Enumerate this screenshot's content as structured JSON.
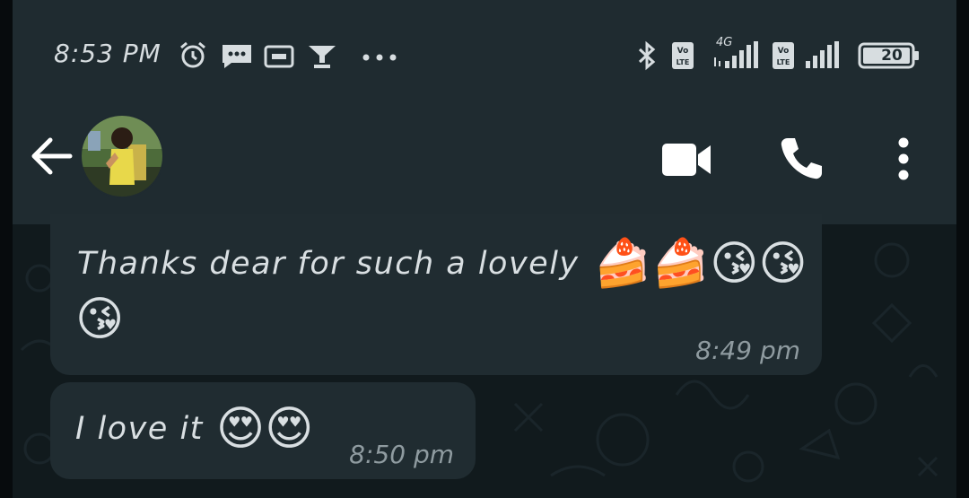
{
  "status_bar": {
    "time": "8:53 PM",
    "battery": "20",
    "network_label": "4G",
    "sim_labels": [
      "Vo LTE",
      "Vo LTE"
    ],
    "icons": [
      "alarm-icon",
      "message-icon",
      "screen-icon",
      "funnel-icon",
      "more-dots-icon",
      "bluetooth-icon",
      "volte-icon",
      "signal-icon",
      "battery-icon"
    ]
  },
  "app_bar": {
    "icons": [
      "back-arrow-icon",
      "avatar",
      "video-call-icon",
      "phone-call-icon",
      "more-vert-icon"
    ]
  },
  "messages": [
    {
      "text": "Thanks dear for such a lovely",
      "emoji_line1": [
        "🍰",
        "🍰",
        "😘",
        "😘"
      ],
      "emoji_line2": [
        "😘"
      ],
      "time": "8:49 pm"
    },
    {
      "text": "I love it",
      "emoji": [
        "😍",
        "😍"
      ],
      "time": "8:50 pm"
    }
  ],
  "colors": {
    "header": "#1f2b30",
    "chat_background": "#111a1d",
    "bubble": "#202c31",
    "text": "#d9dfe2",
    "timestamp": "#8f9ba0"
  }
}
